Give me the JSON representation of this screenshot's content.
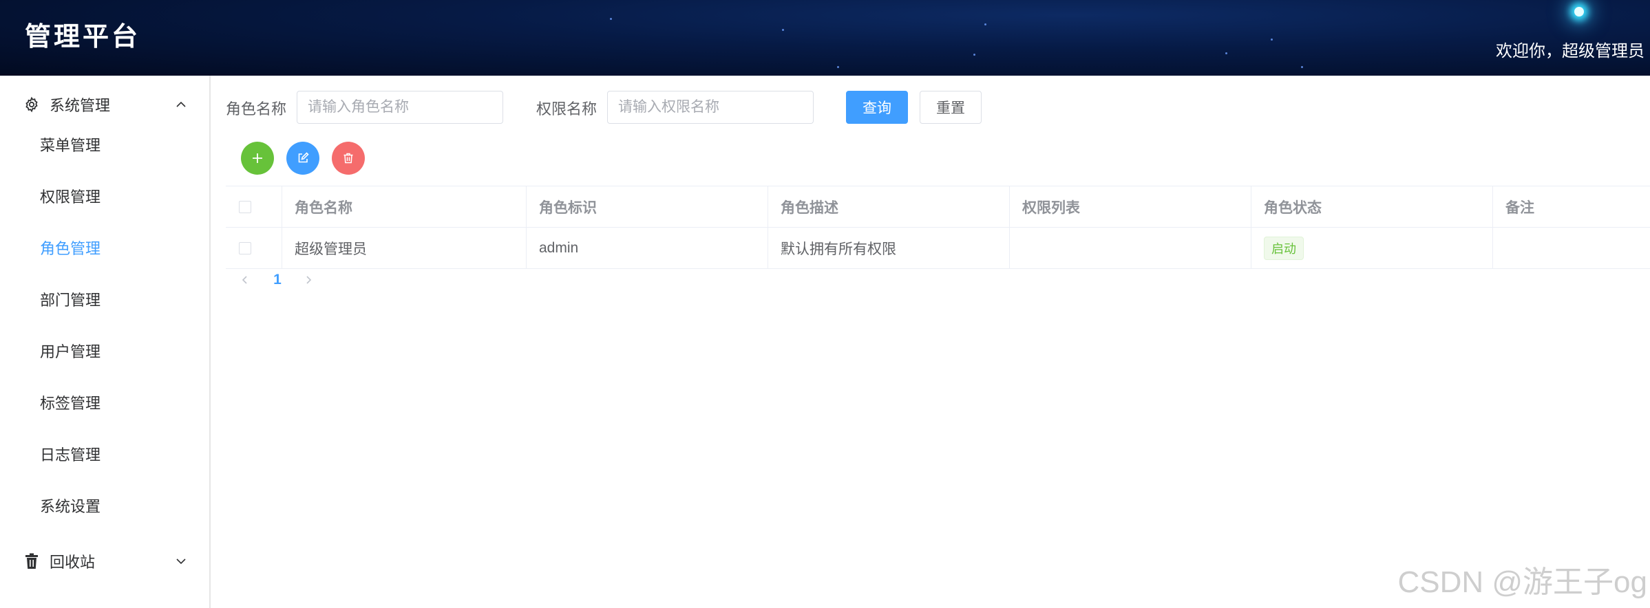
{
  "header": {
    "title": "管理平台",
    "welcome": "欢迎你，超级管理员"
  },
  "sidebar": {
    "group_system": {
      "label": "系统管理",
      "icon": "gear-icon",
      "expanded": true
    },
    "items": [
      {
        "label": "菜单管理",
        "active": false
      },
      {
        "label": "权限管理",
        "active": false
      },
      {
        "label": "角色管理",
        "active": true
      },
      {
        "label": "部门管理",
        "active": false
      },
      {
        "label": "用户管理",
        "active": false
      },
      {
        "label": "标签管理",
        "active": false
      },
      {
        "label": "日志管理",
        "active": false
      },
      {
        "label": "系统设置",
        "active": false
      }
    ],
    "group_recycle": {
      "label": "回收站",
      "icon": "trash-icon",
      "expanded": false
    }
  },
  "search": {
    "role_name_label": "角色名称",
    "role_name_placeholder": "请输入角色名称",
    "role_name_value": "",
    "perm_name_label": "权限名称",
    "perm_name_placeholder": "请输入权限名称",
    "perm_name_value": "",
    "query_label": "查询",
    "reset_label": "重置"
  },
  "actions": {
    "add_icon": "plus-icon",
    "edit_icon": "edit-icon",
    "delete_icon": "trash-icon"
  },
  "table": {
    "columns": [
      "角色名称",
      "角色标识",
      "角色描述",
      "权限列表",
      "角色状态",
      "备注"
    ],
    "rows": [
      {
        "name": "超级管理员",
        "key": "admin",
        "description": "默认拥有所有权限",
        "permissions": "",
        "status": "启动",
        "remark": ""
      }
    ]
  },
  "pagination": {
    "current_page": "1"
  },
  "watermark": "CSDN @游王子og",
  "colors": {
    "primary": "#409eff",
    "success": "#67c23a",
    "danger": "#f56c6c",
    "header_bg": "#061a45"
  }
}
